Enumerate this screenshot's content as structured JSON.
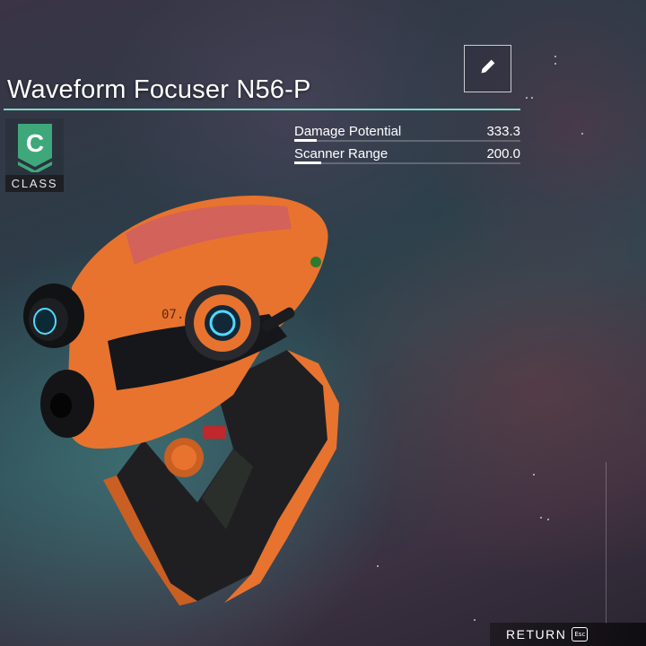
{
  "item": {
    "title": "Waveform Focuser N56-P",
    "class_letter": "C",
    "class_label": "CLASS"
  },
  "stats": [
    {
      "label": "Damage Potential",
      "value": "333.3",
      "level": 0.1
    },
    {
      "label": "Scanner Range",
      "value": "200.0",
      "level": 0.12
    }
  ],
  "footer": {
    "return_label": "RETURN",
    "esc_label": "Esc"
  },
  "colors": {
    "accent": "#7fd6c7",
    "class_badge": "#3fa87a",
    "weapon_body": "#e8732e",
    "weapon_grip": "#1f1f22",
    "lens_glow": "#52d8ff"
  },
  "icons": {
    "edit": "pencil-icon",
    "class": "class-c-chevron-icon"
  }
}
